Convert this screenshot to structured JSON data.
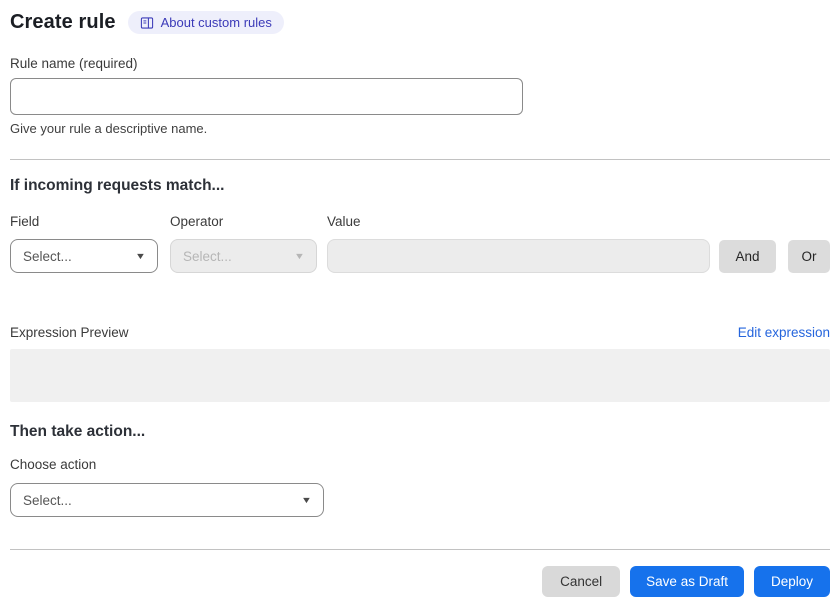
{
  "page": {
    "title": "Create rule",
    "badge": {
      "label": "About custom rules",
      "icon": "book-icon"
    }
  },
  "rule_name": {
    "label": "Rule name (required)",
    "value": "",
    "helper": "Give your rule a descriptive name."
  },
  "match_section": {
    "heading": "If incoming requests match...",
    "columns": {
      "field": "Field",
      "operator": "Operator",
      "value": "Value"
    },
    "field_select": {
      "value": "Select...",
      "disabled": false
    },
    "operator_select": {
      "value": "Select...",
      "disabled": true
    },
    "value_input": {
      "value": "",
      "disabled": true
    },
    "and_button": "And",
    "or_button": "Or"
  },
  "expression": {
    "label": "Expression Preview",
    "edit_link": "Edit expression",
    "preview_value": ""
  },
  "action_section": {
    "heading": "Then take action...",
    "label": "Choose action",
    "action_select": {
      "value": "Select...",
      "disabled": false
    }
  },
  "footer": {
    "cancel": "Cancel",
    "save_draft": "Save as Draft",
    "deploy": "Deploy"
  },
  "colors": {
    "accent_blue": "#1672ec",
    "link_blue": "#2565dd",
    "badge_bg": "#eeeffb",
    "badge_text": "#3b3ab8",
    "disabled_bg": "#ececec",
    "gray_button_bg": "#dcdcdc"
  }
}
